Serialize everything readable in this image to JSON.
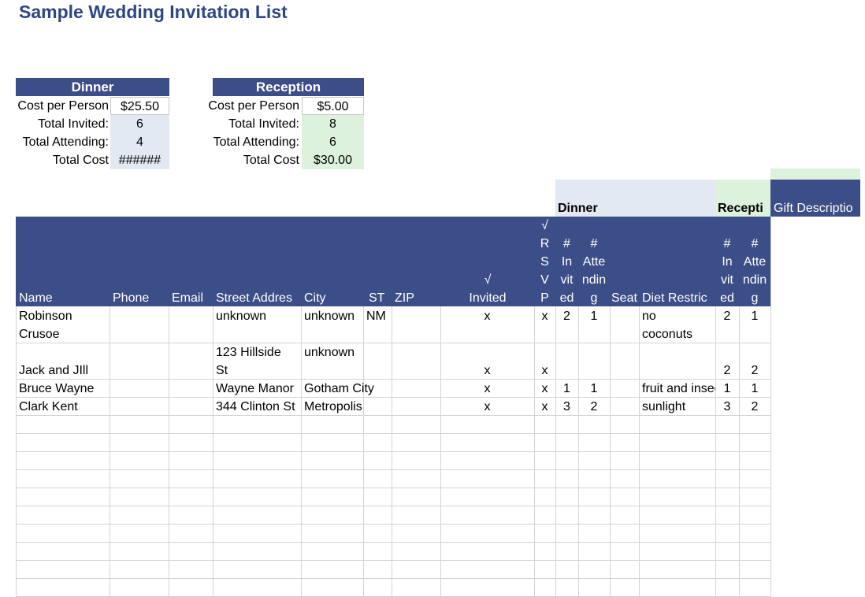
{
  "title": "Sample Wedding Invitation List",
  "dinner_summary": {
    "header": "Dinner",
    "cost_label": "Cost per Person",
    "cost_value": "$25.50",
    "invited_label": "Total Invited:",
    "invited_value": "6",
    "attending_label": "Total Attending:",
    "attending_value": "4",
    "total_label": "Total Cost",
    "total_value": "######"
  },
  "reception_summary": {
    "header": "Reception",
    "cost_label": "Cost per Person",
    "cost_value": "$5.00",
    "invited_label": "Total Invited:",
    "invited_value": "8",
    "attending_label": "Total Attending:",
    "attending_value": "6",
    "total_label": "Total Cost",
    "total_value": "$30.00"
  },
  "band": {
    "dinner": "Dinner",
    "reception": "Recepti",
    "gift": "Gift Descriptio"
  },
  "headers": {
    "name": "Name",
    "phone": "Phone",
    "email": "Email",
    "street": "Street Addres",
    "city": "City",
    "st": "ST",
    "zip": "ZIP",
    "invited_mark": "√",
    "invited": "Invited",
    "rsvp": "√\nR\nS\nV\nP",
    "d_invited": "#\nIn\nvit\ned",
    "d_attending": "#\nAtte\nndin\ng",
    "seat": "Seat",
    "diet": "Diet Restric",
    "r_invited": "#\nIn\nvit\ned",
    "r_attending": "#\nAtte\nndin\ng"
  },
  "rows": [
    {
      "name_1": "Robinson",
      "name_2": "Crusoe",
      "street": "unknown",
      "city": "unknown",
      "st": "NM",
      "invited": "x",
      "rsvp": "x",
      "d_inv": "2",
      "d_att": "1",
      "diet_1": "no",
      "diet_2": "coconuts",
      "r_inv": "2",
      "r_att": "1"
    },
    {
      "name": "Jack and JIll",
      "street_1": "123 Hillside",
      "street_2": "St",
      "city": "unknown",
      "invited": "x",
      "rsvp": "x",
      "r_inv": "2",
      "r_att": "2"
    },
    {
      "name": "Bruce Wayne",
      "street": "Wayne Manor",
      "city": "Gotham City",
      "invited": "x",
      "rsvp": "x",
      "d_inv": "1",
      "d_att": "1",
      "diet": "fruit and insects",
      "r_inv": "1",
      "r_att": "1"
    },
    {
      "name": "Clark Kent",
      "street": "344 Clinton St",
      "city": "Metropolis",
      "invited": "x",
      "rsvp": "x",
      "d_inv": "3",
      "d_att": "2",
      "diet": "sunlight",
      "r_inv": "3",
      "r_att": "2"
    }
  ],
  "colors": {
    "header": "#3b4e87",
    "title": "#2f4585",
    "dinner_band": "#e3e9f2",
    "reception_band": "#dcf2dc",
    "grid": "#d4d4d4"
  }
}
